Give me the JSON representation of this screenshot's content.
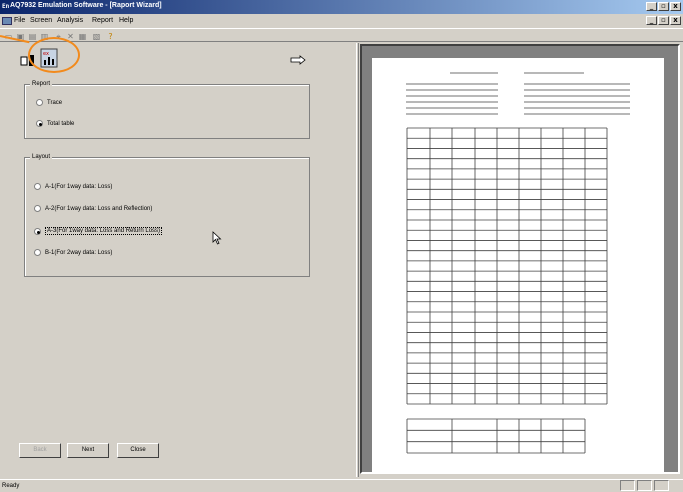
{
  "window": {
    "icon": "En",
    "title": "AQ7932 Emulation Software - [Raport Wizard]"
  },
  "menu": [
    "File",
    "Screen",
    "Analysis",
    "Report",
    "Help"
  ],
  "report_group": {
    "legend": "Report",
    "options": [
      {
        "label": "Trace",
        "selected": false
      },
      {
        "label": "Total table",
        "selected": true
      }
    ]
  },
  "layout_group": {
    "legend": "Layout",
    "options": [
      {
        "label": "A-1(For 1way data: Loss)",
        "selected": false
      },
      {
        "label": "A-2(For 1way data: Loss and Reflection)",
        "selected": false
      },
      {
        "label": "A-3(For 1way data: Loss and Return Loss)",
        "selected": true
      },
      {
        "label": "B-1(For 2way data: Loss)",
        "selected": false
      }
    ]
  },
  "buttons": {
    "back": "Back",
    "next": "Next",
    "close": "Close"
  },
  "status": "Ready",
  "colors": {
    "highlight": "#f28a1c",
    "titlebar_start": "#0a246a",
    "titlebar_end": "#a6caf0"
  }
}
